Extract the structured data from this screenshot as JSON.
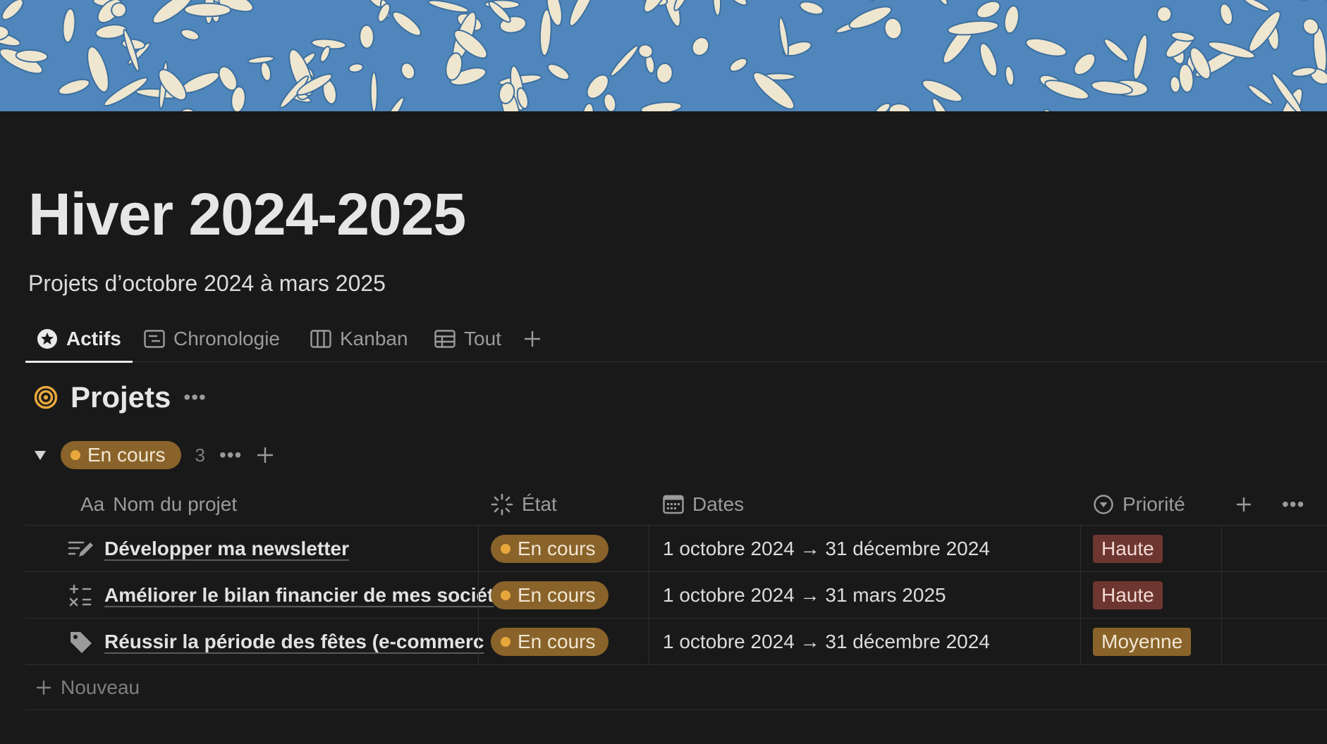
{
  "page": {
    "title": "Hiver 2024-2025",
    "description": "Projets d’octobre 2024 à mars 2025"
  },
  "tabs": [
    {
      "label": "Actifs",
      "icon": "star-circle-icon",
      "active": true
    },
    {
      "label": "Chronologie",
      "icon": "timeline-icon",
      "active": false
    },
    {
      "label": "Kanban",
      "icon": "board-icon",
      "active": false
    },
    {
      "label": "Tout",
      "icon": "table-icon",
      "active": false
    }
  ],
  "database": {
    "title": "Projets",
    "icon": "target-icon",
    "icon_color": "#e8a73d"
  },
  "group": {
    "label": "En cours",
    "count": "3"
  },
  "columns": {
    "name": "Nom du projet",
    "name_prefix": "Aa",
    "etat": "État",
    "dates": "Dates",
    "priorite": "Priorité"
  },
  "rows": [
    {
      "icon": "pen-lines-icon",
      "name": "Développer ma newsletter",
      "etat": "En cours",
      "dates": "1 octobre 2024 → 31 décembre 2024",
      "priorite": "Haute",
      "priorite_level": "haute"
    },
    {
      "icon": "calculator-icon",
      "name": "Améliorer le bilan financier de mes sociét",
      "etat": "En cours",
      "dates": "1 octobre 2024 → 31 mars 2025",
      "priorite": "Haute",
      "priorite_level": "haute"
    },
    {
      "icon": "tag-icon",
      "name": "Réussir la période des fêtes (e-commerc",
      "etat": "En cours",
      "dates": "1 octobre 2024 → 31 décembre 2024",
      "priorite": "Moyenne",
      "priorite_level": "moyenne"
    }
  ],
  "new_row_label": "Nouveau",
  "colors": {
    "background": "#191919",
    "status_orange": "#89632a",
    "priority_high": "#6e3630",
    "priority_medium": "#89632a"
  }
}
